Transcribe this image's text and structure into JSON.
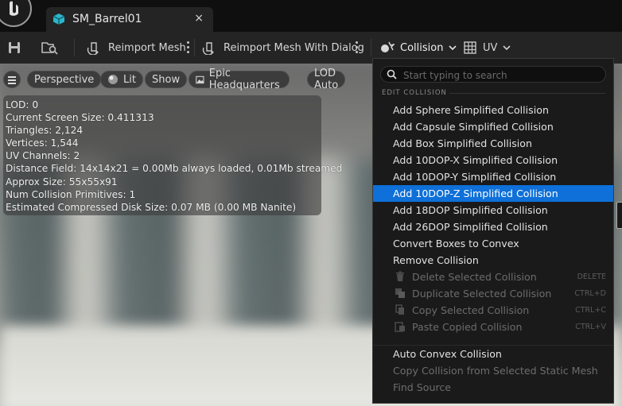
{
  "tab": {
    "title": "SM_Barrel01",
    "close": "×"
  },
  "toolbar": {
    "reimport": "Reimport Mesh",
    "reimport_dialog": "Reimport Mesh With Dialog",
    "collision": "Collision",
    "uv": "UV"
  },
  "viewport_toolbar": {
    "perspective": "Perspective",
    "lit": "Lit",
    "show": "Show",
    "environment": "Epic Headquarters",
    "lod": "LOD Auto"
  },
  "stats": [
    "LOD:  0",
    "Current Screen Size:  0.411313",
    "Triangles:  2,124",
    "Vertices:  1,544",
    "UV Channels:  2",
    "Distance Field:  14x14x21 = 0.00Mb always loaded, 0.01Mb streamed",
    "Approx Size: 55x55x91",
    "Num Collision Primitives:  1",
    "Estimated Compressed Disk Size: 0.07 MB (0.00 MB Nanite)"
  ],
  "menu": {
    "search_placeholder": "Start typing to search",
    "section": "EDIT COLLISION",
    "items": [
      {
        "label": "Add Sphere Simplified Collision"
      },
      {
        "label": "Add Capsule Simplified Collision"
      },
      {
        "label": "Add Box Simplified Collision"
      },
      {
        "label": "Add 10DOP-X Simplified Collision"
      },
      {
        "label": "Add 10DOP-Y Simplified Collision"
      },
      {
        "label": "Add 10DOP-Z Simplified Collision"
      },
      {
        "label": "Add 18DOP Simplified Collision"
      },
      {
        "label": "Add 26DOP Simplified Collision"
      },
      {
        "label": "Convert Boxes to Convex"
      },
      {
        "label": "Remove Collision"
      },
      {
        "label": "Delete Selected Collision",
        "shortcut": "DELETE",
        "icon": "trash-icon"
      },
      {
        "label": "Duplicate Selected Collision",
        "shortcut": "CTRL+D",
        "icon": "duplicate-icon"
      },
      {
        "label": "Copy Selected Collision",
        "shortcut": "CTRL+C",
        "icon": "copy-icon"
      },
      {
        "label": "Paste Copied Collision",
        "shortcut": "CTRL+V",
        "icon": "paste-icon"
      },
      {
        "label": "Auto Convex Collision"
      },
      {
        "label": "Copy Collision from Selected Static Mesh"
      },
      {
        "label": "Find Source"
      }
    ]
  },
  "colors": {
    "highlight": "#0e70d8",
    "tab_icon": "#2bb5c9"
  }
}
